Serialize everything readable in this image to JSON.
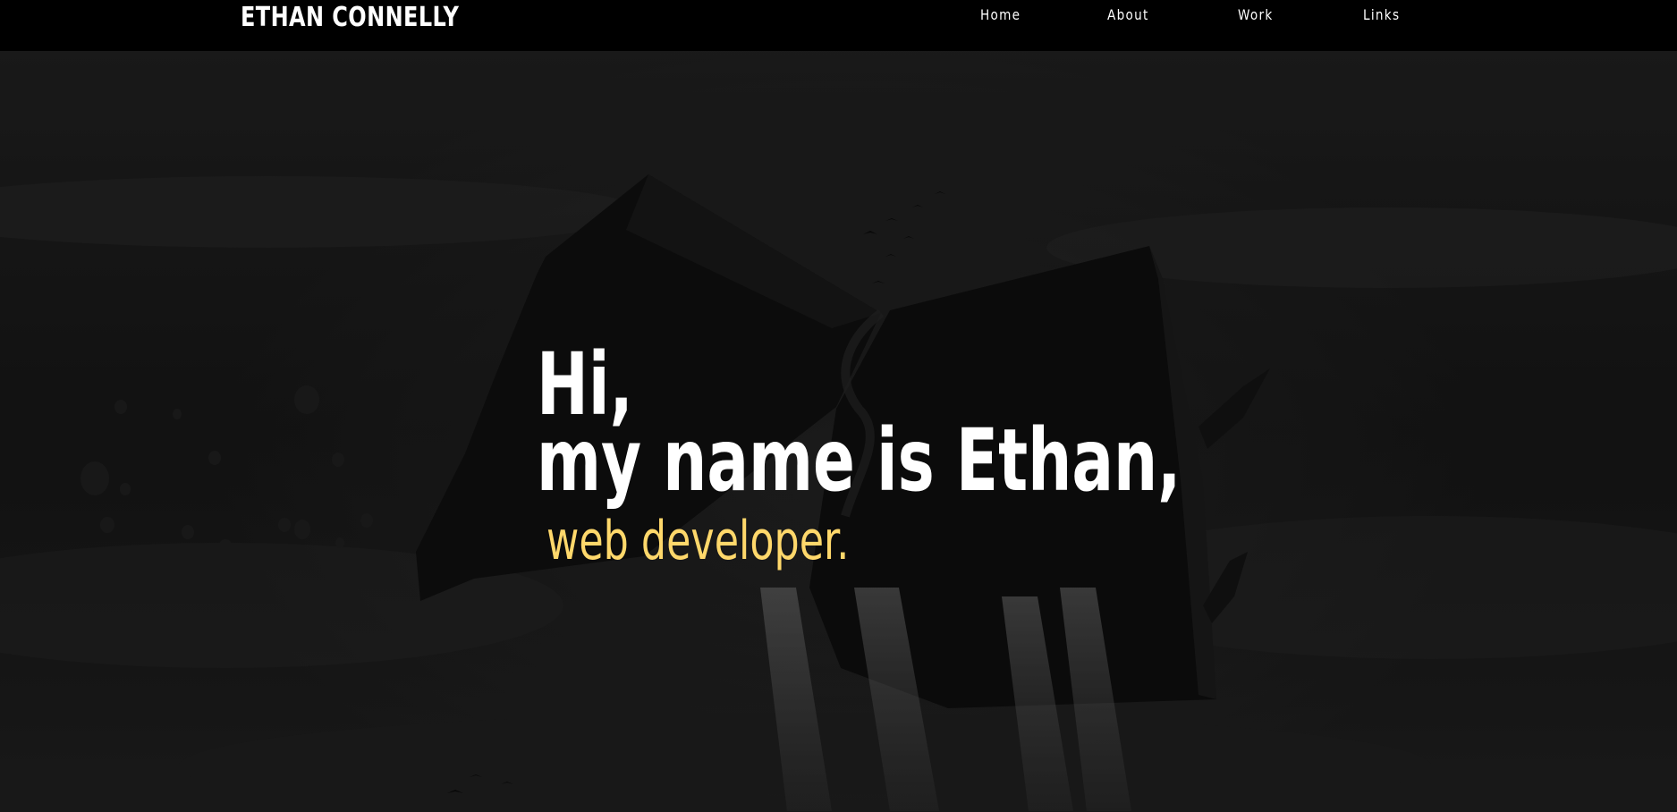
{
  "nav": {
    "brand": "ETHAN CONNELLY",
    "items": [
      {
        "label": "Home"
      },
      {
        "label": "About"
      },
      {
        "label": "Work"
      },
      {
        "label": "Links"
      }
    ]
  },
  "hero": {
    "greeting": "Hi,",
    "name_line": "my name is Ethan,",
    "role": "web developer.",
    "accent_color": "#ffd86b",
    "background_image": "dark-surreal-open-book-with-waterfalls-and-hot-air-balloons"
  }
}
